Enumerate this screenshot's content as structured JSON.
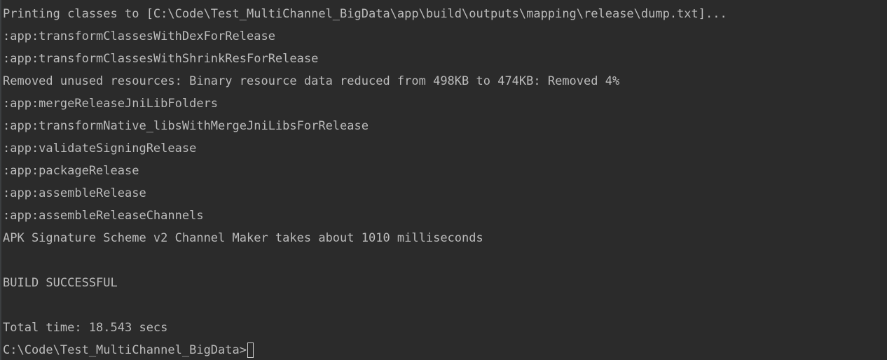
{
  "terminal": {
    "lines": [
      "Printing classes to [C:\\Code\\Test_MultiChannel_BigData\\app\\build\\outputs\\mapping\\release\\dump.txt]...",
      ":app:transformClassesWithDexForRelease",
      ":app:transformClassesWithShrinkResForRelease",
      "Removed unused resources: Binary resource data reduced from 498KB to 474KB: Removed 4%",
      ":app:mergeReleaseJniLibFolders",
      ":app:transformNative_libsWithMergeJniLibsForRelease",
      ":app:validateSigningRelease",
      ":app:packageRelease",
      ":app:assembleRelease",
      ":app:assembleReleaseChannels",
      "APK Signature Scheme v2 Channel Maker takes about 1010 milliseconds",
      "",
      "BUILD SUCCESSFUL",
      "",
      "Total time: 18.543 secs"
    ],
    "prompt": "C:\\Code\\Test_MultiChannel_BigData>"
  },
  "colors": {
    "background": "#2b2b2b",
    "text": "#bbbbbb"
  }
}
